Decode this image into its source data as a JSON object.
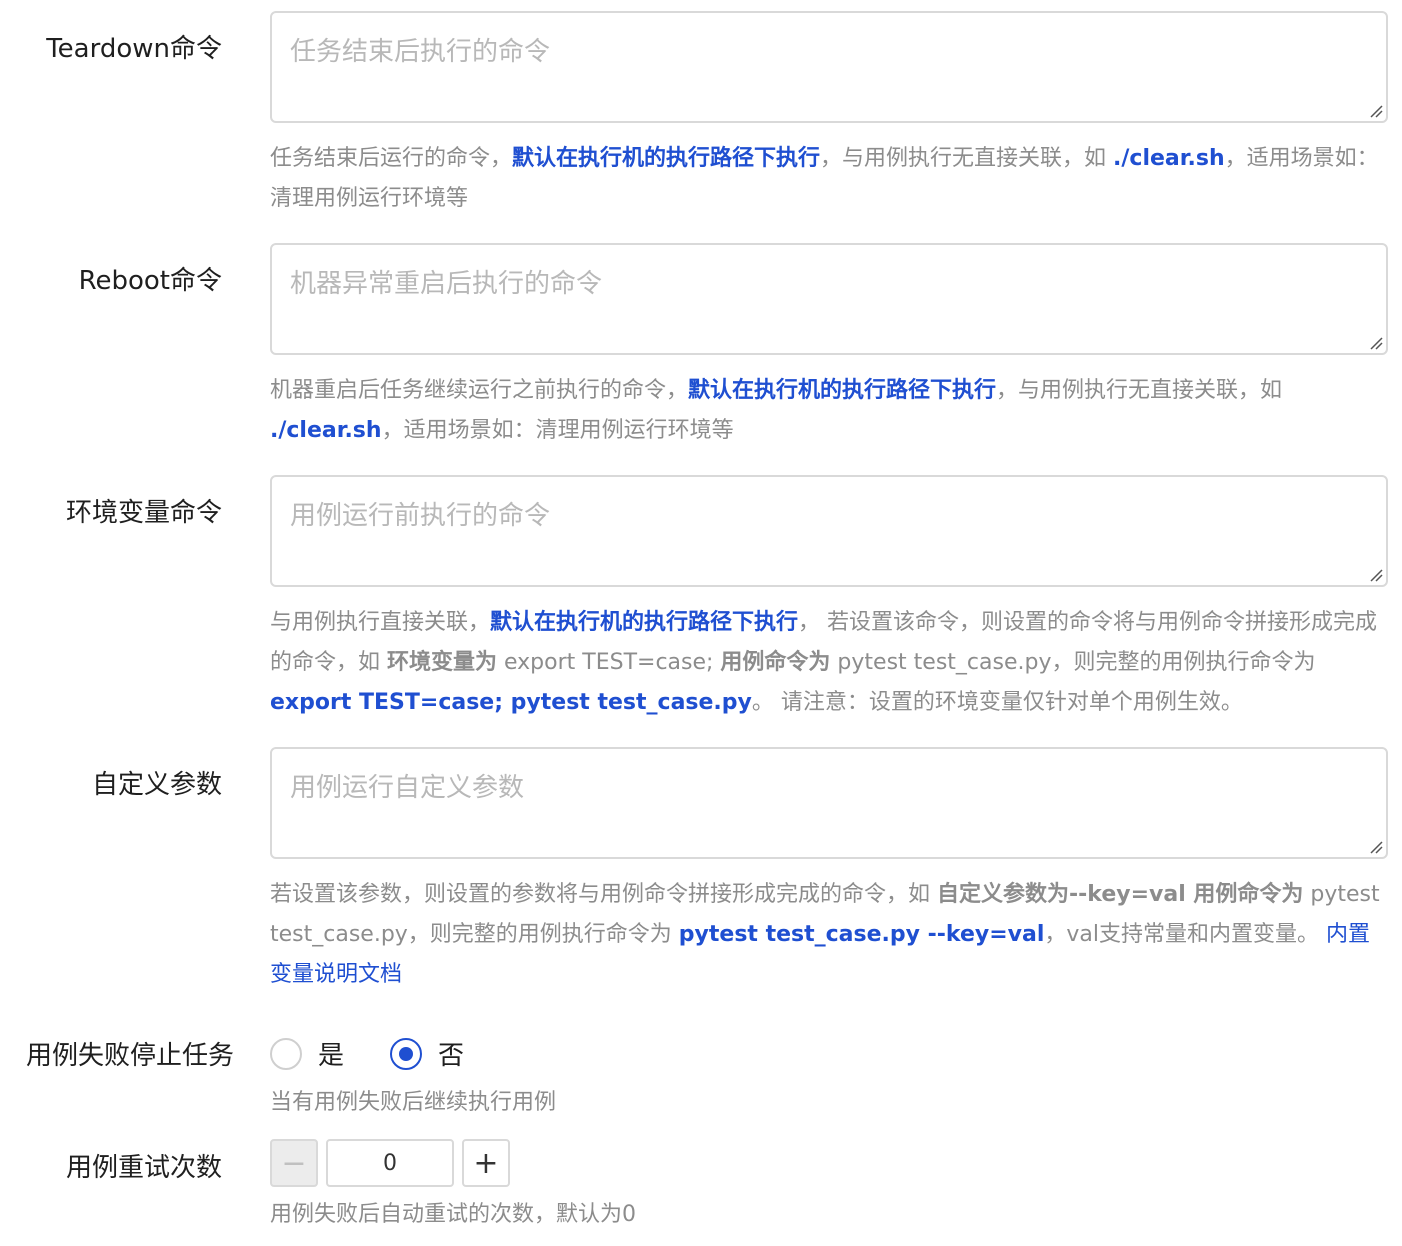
{
  "teardown": {
    "label": "Teardown命令",
    "placeholder": "任务结束后执行的命令",
    "help": {
      "p1": "任务结束后运行的命令，",
      "link1": "默认在执行机的执行路径下执行",
      "p2": "，与用例执行无直接关联，如 ",
      "link2": "./clear.sh",
      "p3": "，适用场景如：清理用例运行环境等"
    }
  },
  "reboot": {
    "label": "Reboot命令",
    "placeholder": "机器异常重启后执行的命令",
    "help": {
      "p1": "机器重启后任务继续运行之前执行的命令，",
      "link1": "默认在执行机的执行路径下执行",
      "p2": "，与用例执行无直接关联，如 ",
      "link2": "./clear.sh",
      "p3": "，适用场景如：清理用例运行环境等"
    }
  },
  "env": {
    "label": "环境变量命令",
    "placeholder": "用例运行前执行的命令",
    "help": {
      "p1": "与用例执行直接关联，",
      "link1": "默认在执行机的执行路径下执行",
      "p2": "， 若设置该命令，则设置的命令将与用例命令拼接形成完成的命令，如 ",
      "b1": "环境变量为",
      "p3": " export TEST=case; ",
      "b2": "用例命令为",
      "p4": " pytest test_case.py，则完整的用例执行命令为 ",
      "link2": "export TEST=case; pytest test_case.py",
      "p5": "。 请注意：设置的环境变量仅针对单个用例生效。"
    }
  },
  "custom": {
    "label": "自定义参数",
    "placeholder": "用例运行自定义参数",
    "help": {
      "p1": "若设置该参数，则设置的参数将与用例命令拼接形成完成的命令，如 ",
      "b1": "自定义参数为",
      "p2": "--key=val ",
      "b2": "用例命令为",
      "p3": " pytest test_case.py，则完整的用例执行命令为 ",
      "link1": "pytest test_case.py --key=val",
      "p4": "，val支持常量和内置变量。 ",
      "doc_link": "内置变量说明文档"
    }
  },
  "stop_on_fail": {
    "label": "用例失败停止任务",
    "options": [
      "是",
      "否"
    ],
    "selected": "否",
    "help": "当有用例失败后继续执行用例"
  },
  "retry": {
    "label": "用例重试次数",
    "value": "0",
    "minus": "−",
    "plus": "+",
    "help": "用例失败后自动重试的次数，默认为0"
  },
  "colors": {
    "accent": "#1f4fd1",
    "help_text": "#8c8c8c",
    "border": "#d9d9d9"
  }
}
